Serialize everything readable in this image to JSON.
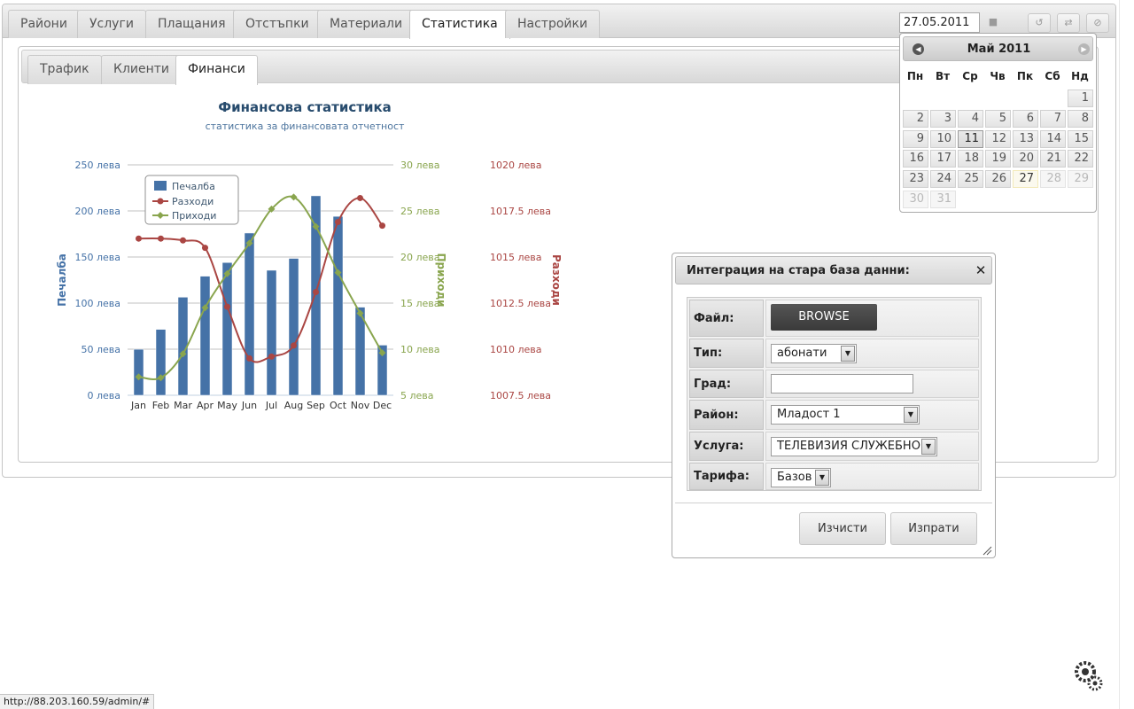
{
  "top_tabs": [
    {
      "label": "Райони",
      "active": false
    },
    {
      "label": "Услуги",
      "active": false
    },
    {
      "label": "Плащания",
      "active": false
    },
    {
      "label": "Отстъпки",
      "active": false
    },
    {
      "label": "Материали",
      "active": false
    },
    {
      "label": "Статистика",
      "active": true
    },
    {
      "label": "Настройки",
      "active": false
    }
  ],
  "toolbar": {
    "date_value": "27.05.2011",
    "icons": [
      "pin-icon",
      "refresh-icon",
      "swap-icon",
      "cancel-icon"
    ]
  },
  "sub_tabs": [
    {
      "label": "Трафик",
      "active": false
    },
    {
      "label": "Клиенти",
      "active": false
    },
    {
      "label": "Финанси",
      "active": true
    }
  ],
  "chart_data": {
    "type": "bar+line",
    "title": "Финансова статистика",
    "subtitle": "статистика за финансовата отчетност",
    "categories": [
      "Jan",
      "Feb",
      "Mar",
      "Apr",
      "May",
      "Jun",
      "Jul",
      "Aug",
      "Sep",
      "Oct",
      "Nov",
      "Dec"
    ],
    "axes": {
      "left": {
        "label": "Печалба",
        "ticks": [
          "250 лева",
          "200 лева",
          "150 лева",
          "100 лева",
          "50 лева",
          "0 лева"
        ],
        "range": [
          0,
          250
        ]
      },
      "right_inner": {
        "label": "Приходи",
        "ticks": [
          "30 лева",
          "25 лева",
          "20 лева",
          "15 лева",
          "10 лева",
          "5 лева"
        ],
        "range": [
          5,
          30
        ]
      },
      "right_outer": {
        "label": "Разходи",
        "ticks": [
          "1020 лева",
          "1017.5 лева",
          "1015 лева",
          "1012.5 лева",
          "1010 лева",
          "1007.5 лева"
        ],
        "range": [
          1007.5,
          1020
        ]
      }
    },
    "grid": true,
    "legend_position": "top-left",
    "series": [
      {
        "name": "Печалба",
        "type": "bar",
        "axis": "left",
        "color": "#4572a7",
        "values": [
          49.9,
          71.5,
          106.4,
          129.2,
          144.0,
          176.0,
          135.6,
          148.5,
          216.4,
          194.1,
          95.6,
          54.4
        ]
      },
      {
        "name": "Разходи",
        "type": "spline",
        "axis": "right_outer",
        "color": "#aa4643",
        "values": [
          1016.0,
          1016.0,
          1015.9,
          1015.5,
          1012.3,
          1009.5,
          1009.6,
          1010.2,
          1013.1,
          1016.9,
          1018.2,
          1016.7
        ]
      },
      {
        "name": "Приходи",
        "type": "spline",
        "axis": "right_inner",
        "color": "#89a54e",
        "values": [
          7.0,
          6.9,
          9.5,
          14.5,
          18.2,
          21.5,
          25.2,
          26.5,
          23.3,
          18.3,
          13.9,
          9.6
        ]
      }
    ]
  },
  "calendar": {
    "title": "Май 2011",
    "weekdays": [
      "Пн",
      "Вт",
      "Ср",
      "Чв",
      "Пк",
      "Сб",
      "Нд"
    ],
    "rows": [
      [
        null,
        null,
        null,
        null,
        null,
        null,
        "1"
      ],
      [
        "2",
        "3",
        "4",
        "5",
        "6",
        "7",
        "8"
      ],
      [
        "9",
        "10",
        "11",
        "12",
        "13",
        "14",
        "15"
      ],
      [
        "16",
        "17",
        "18",
        "19",
        "20",
        "21",
        "22"
      ],
      [
        "23",
        "24",
        "25",
        "26",
        "27",
        "28",
        "29"
      ],
      [
        "30",
        "31",
        null,
        null,
        null,
        null,
        null
      ]
    ],
    "highlighted_day": "11",
    "today_day": "27",
    "disabled_days": [
      "28",
      "29",
      "30",
      "31"
    ]
  },
  "dialog": {
    "title": "Интеграция на стара база данни:",
    "close_icon": "close-icon",
    "fields": {
      "file_label": "Файл:",
      "browse_label": "BROWSE",
      "type_label": "Тип:",
      "type_value": "абонати",
      "city_label": "Град:",
      "city_value": "",
      "district_label": "Район:",
      "district_value": "Младост 1",
      "service_label": "Услуга:",
      "service_value": "ТЕЛЕВИЗИЯ СЛУЖЕБНО",
      "tariff_label": "Тарифа:",
      "tariff_value": "Базов"
    },
    "buttons": {
      "clear": "Изчисти",
      "send": "Изпрати"
    }
  },
  "status_bar": {
    "url": "http://88.203.160.59/admin/#"
  },
  "colors": {
    "profit": "#4572a7",
    "expenses": "#aa4643",
    "income": "#89a54e",
    "title": "#274b6d"
  }
}
